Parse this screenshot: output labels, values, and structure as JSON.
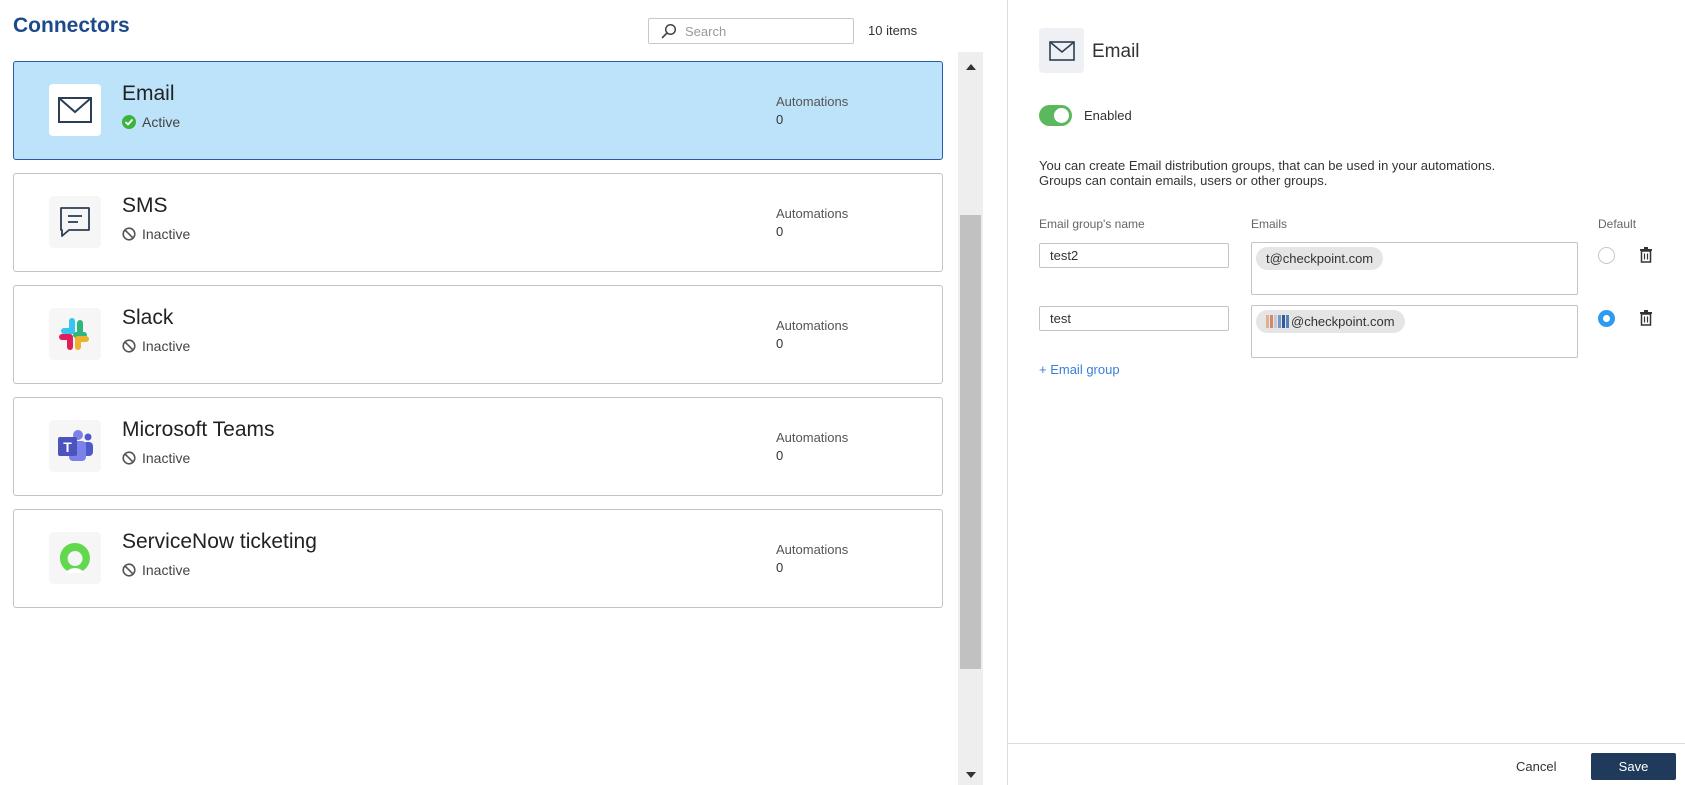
{
  "page_title": "Connectors",
  "search": {
    "placeholder": "Search"
  },
  "item_count": "10 items",
  "connectors": [
    {
      "name": "Email",
      "status": "Active",
      "status_icon": "check-circle-icon",
      "automations_label": "Automations",
      "automations": "0",
      "selected": true
    },
    {
      "name": "SMS",
      "status": "Inactive",
      "status_icon": "disabled-icon",
      "automations_label": "Automations",
      "automations": "0"
    },
    {
      "name": "Slack",
      "status": "Inactive",
      "status_icon": "disabled-icon",
      "automations_label": "Automations",
      "automations": "0"
    },
    {
      "name": "Microsoft Teams",
      "status": "Inactive",
      "status_icon": "disabled-icon",
      "automations_label": "Automations",
      "automations": "0"
    },
    {
      "name": "ServiceNow ticketing",
      "status": "Inactive",
      "status_icon": "disabled-icon",
      "automations_label": "Automations",
      "automations": "0"
    }
  ],
  "detail": {
    "title": "Email",
    "toggle_label": "Enabled",
    "description_line1": "You can create Email distribution groups, that can be used in your automations.",
    "description_line2": "Groups can contain emails, users or other groups.",
    "col_name": "Email group's name",
    "col_emails": "Emails",
    "col_default": "Default",
    "groups": [
      {
        "name": "test2",
        "email": "t@checkpoint.com",
        "default": false
      },
      {
        "name": "test",
        "email": "@checkpoint.com",
        "default": true
      }
    ],
    "add_group": "+ Email group",
    "cancel": "Cancel",
    "save": "Save"
  },
  "colors": {
    "title": "#1c4a8a",
    "selected_bg": "#bde3fa",
    "selected_border": "#2b5aa6",
    "active_green": "#3cb43c",
    "toggle_green": "#5cb85c",
    "radio_blue": "#2d9bf0",
    "save_bg": "#1f3a5a",
    "link_blue": "#3a7fd6"
  }
}
